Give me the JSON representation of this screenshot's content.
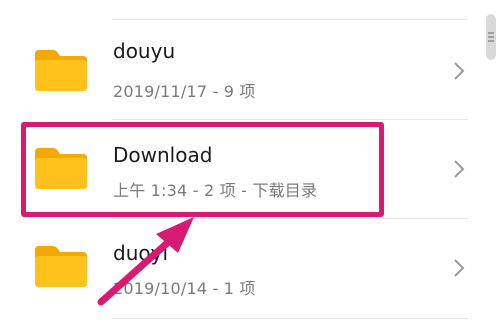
{
  "files": [
    {
      "name": "douyu",
      "meta": "2019/11/17 - 9 项"
    },
    {
      "name": "Download",
      "meta": "上午 1:34  - 2 项 - 下载目录"
    },
    {
      "name": "duoyi",
      "meta": "2019/10/14 - 1 项"
    }
  ],
  "icons": {
    "folder": "folder-icon",
    "chevron": "chevron-right-icon"
  },
  "colors": {
    "folder": "#FFC21D",
    "folder_tab": "#F4A900",
    "highlight": "#D81B72",
    "divider": "#E6E6E6"
  }
}
